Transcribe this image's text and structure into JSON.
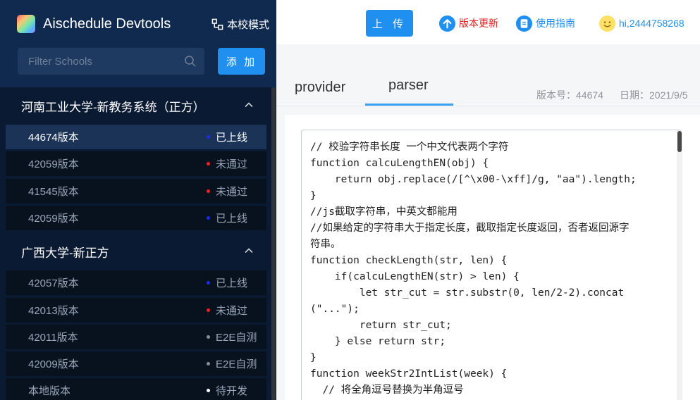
{
  "app": {
    "title": "Aischedule Devtools",
    "mode_label": "本校模式"
  },
  "sidebar": {
    "filter_placeholder": "Filter Schools",
    "add_label": "添 加",
    "groups": [
      {
        "name": "河南工业大学-新教务系统（正方）",
        "rows": [
          {
            "label": "44674版本",
            "status": "已上线",
            "status_color": "#1a2cf0",
            "active": true
          },
          {
            "label": "42059版本",
            "status": "未通过",
            "status_color": "#ff1e1e",
            "active": false
          },
          {
            "label": "41545版本",
            "status": "未通过",
            "status_color": "#ff1e1e",
            "active": false
          },
          {
            "label": "42059版本",
            "status": "已上线",
            "status_color": "#1a2cf0",
            "active": false
          }
        ]
      },
      {
        "name": "广西大学-新正方",
        "rows": [
          {
            "label": "42057版本",
            "status": "已上线",
            "status_color": "#1a2cf0",
            "active": false
          },
          {
            "label": "42013版本",
            "status": "未通过",
            "status_color": "#ff1e1e",
            "active": false
          },
          {
            "label": "42011版本",
            "status": "E2E自测",
            "status_color": "#8a8f96",
            "active": false
          },
          {
            "label": "42009版本",
            "status": "E2E自测",
            "status_color": "#8a8f96",
            "active": false
          },
          {
            "label": "本地版本",
            "status": "待开发",
            "status_color": "#ffffff",
            "active": false
          }
        ]
      }
    ]
  },
  "topbar": {
    "upload_label": "上 传",
    "update_label": "版本更新",
    "update_color": "#e02020",
    "guide_label": "使用指南",
    "guide_color": "#1f8ff0",
    "user_label": "hi,2444758268",
    "user_color": "#1f8ff0"
  },
  "tabs": {
    "items": [
      "provider",
      "parser"
    ],
    "active": "parser",
    "version_label": "版本号：44674",
    "date_label": "日期：2021/9/5"
  },
  "editor": {
    "lines": [
      "// 校验字符串长度 一个中文代表两个字符",
      "function calcuLengthEN(obj) {",
      "    return obj.replace(/[^\\x00-\\xff]/g, \"aa\").length;",
      "}",
      "//js截取字符串，中英文都能用",
      "//如果给定的字符串大于指定长度，截取指定长度返回，否者返回源字",
      "符串。",
      "function checkLength(str, len) {",
      "    if(calcuLengthEN(str) > len) {",
      "        let str_cut = str.substr(0, len/2-2).concat",
      "(\"...\");",
      "        return str_cut;",
      "    } else return str;",
      "}",
      "function weekStr2IntList(week) {",
      "  // 将全角逗号替换为半角逗号"
    ]
  },
  "colors": {
    "accent": "#1f8ff0",
    "sidebar_bg": "#0b1a33",
    "sidebar_header_bg": "#0f2a4e"
  }
}
